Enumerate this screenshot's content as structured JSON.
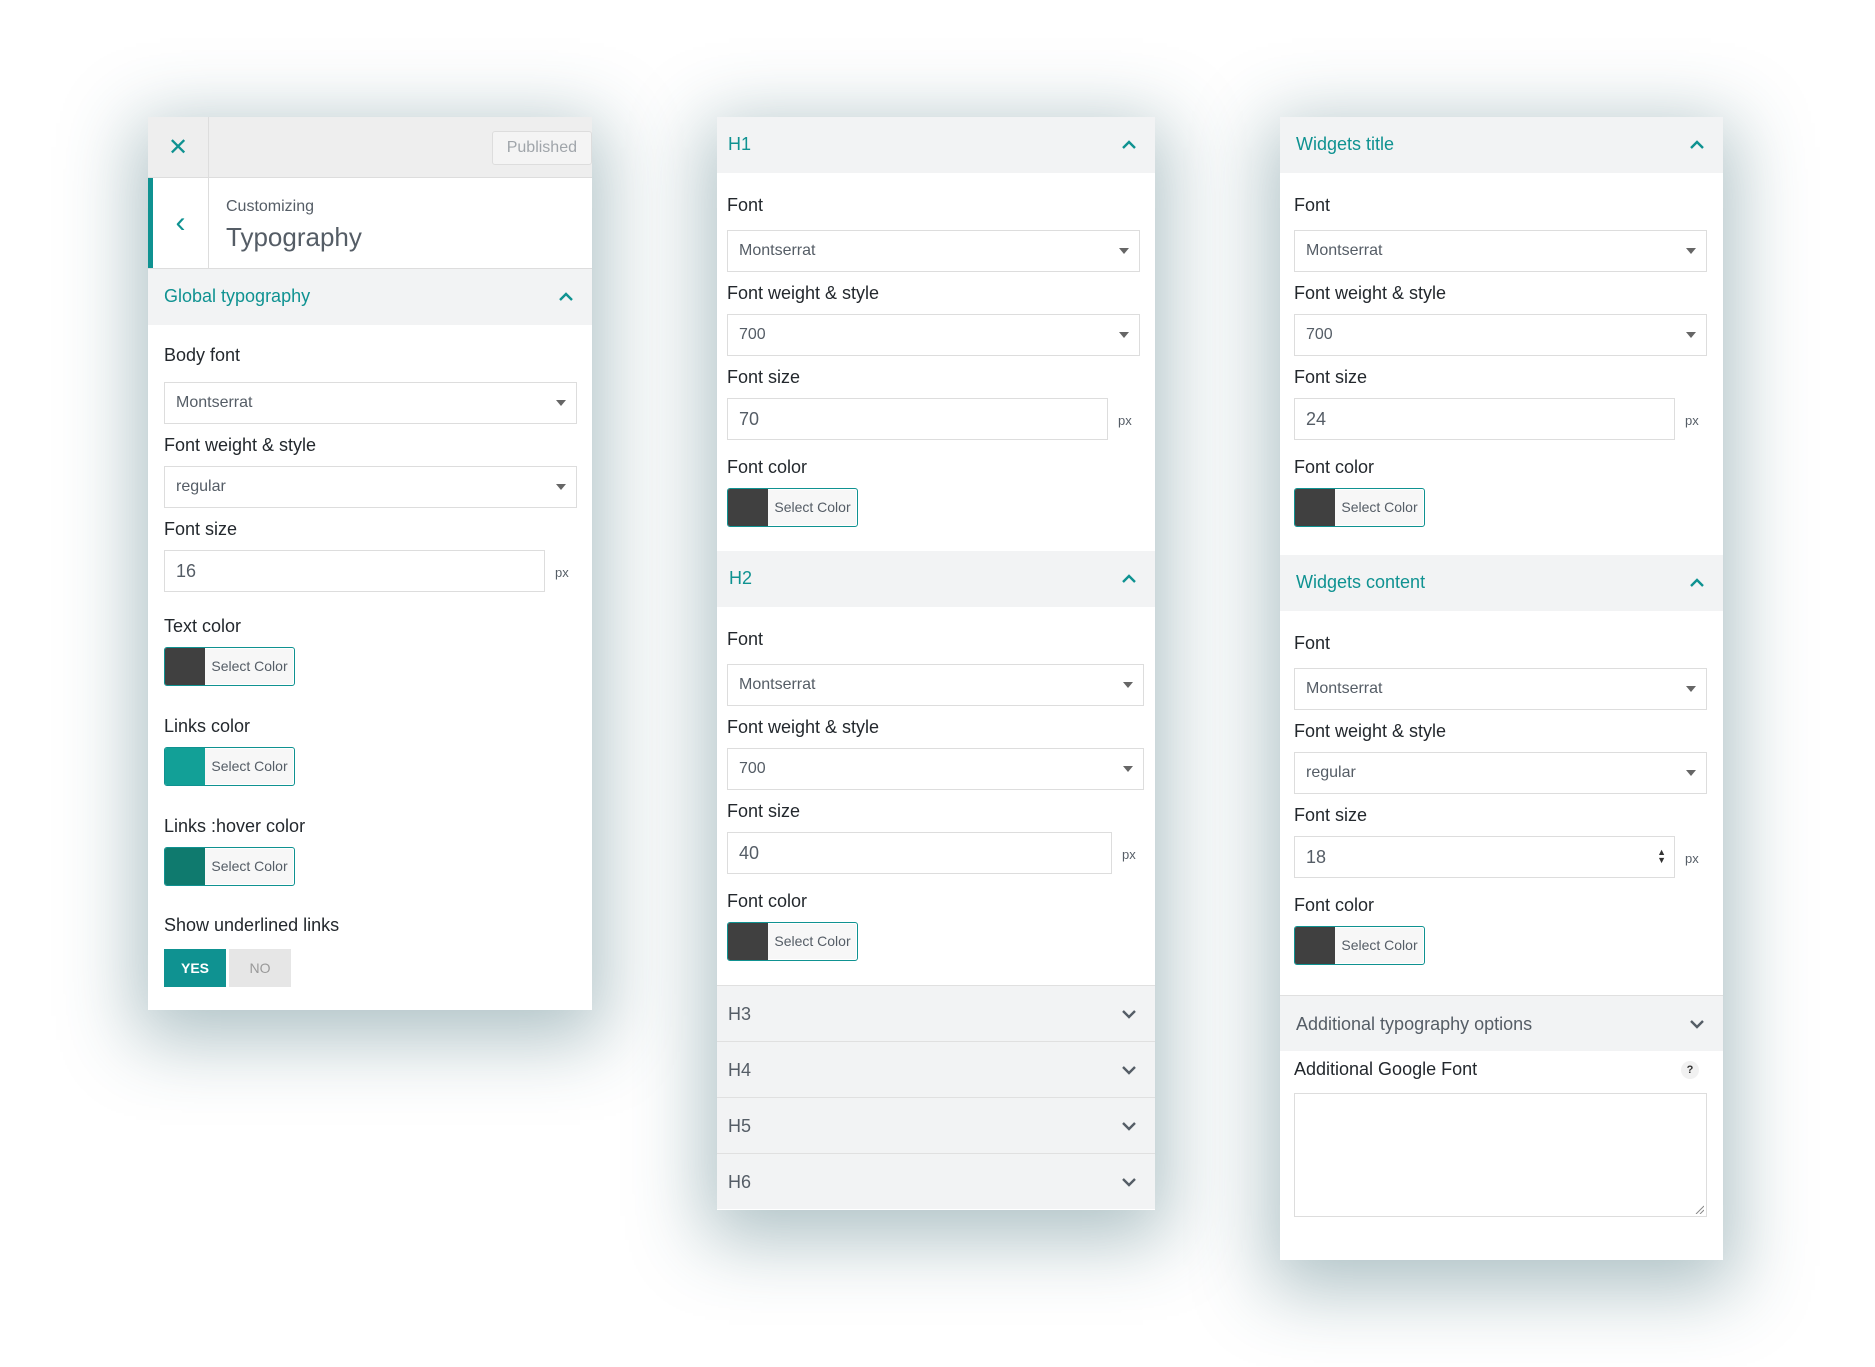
{
  "colors": {
    "accent": "#0f9291",
    "dark_swatch": "#404040",
    "link_swatch": "#12a097",
    "hover_swatch": "#0f7a6e"
  },
  "customizer": {
    "close_icon": "close-icon",
    "published_label": "Published",
    "crumb_small": "Customizing",
    "crumb_title": "Typography",
    "section_title": "Global typography",
    "body_font_label": "Body font",
    "body_font_value": "Montserrat",
    "weight_label": "Font weight & style",
    "weight_value": "regular",
    "size_label": "Font size",
    "size_value": "16",
    "size_unit": "px",
    "text_color_label": "Text color",
    "links_color_label": "Links color",
    "links_hover_label": "Links :hover color",
    "select_color": "Select Color",
    "underline_label": "Show underlined links",
    "yes_label": "YES",
    "no_label": "NO"
  },
  "headings": {
    "h1": {
      "title": "H1",
      "font_label": "Font",
      "font_value": "Montserrat",
      "weight_label": "Font weight & style",
      "weight_value": "700",
      "size_label": "Font size",
      "size_value": "70",
      "size_unit": "px",
      "color_label": "Font color",
      "select_color": "Select Color"
    },
    "h2": {
      "title": "H2",
      "font_label": "Font",
      "font_value": "Montserrat",
      "weight_label": "Font weight & style",
      "weight_value": "700",
      "size_label": "Font size",
      "size_value": "40",
      "size_unit": "px",
      "color_label": "Font color",
      "select_color": "Select Color"
    },
    "collapsed": [
      "H3",
      "H4",
      "H5",
      "H6"
    ]
  },
  "widgets": {
    "title_section": {
      "title": "Widgets title",
      "font_label": "Font",
      "font_value": "Montserrat",
      "weight_label": "Font weight & style",
      "weight_value": "700",
      "size_label": "Font size",
      "size_value": "24",
      "size_unit": "px",
      "color_label": "Font color",
      "select_color": "Select Color"
    },
    "content_section": {
      "title": "Widgets content",
      "font_label": "Font",
      "font_value": "Montserrat",
      "weight_label": "Font weight & style",
      "weight_value": "regular",
      "size_label": "Font size",
      "size_value": "18",
      "size_unit": "px",
      "color_label": "Font color",
      "select_color": "Select Color"
    },
    "additional_title": "Additional typography options",
    "google_font_label": "Additional Google Font",
    "help_icon": "?"
  }
}
